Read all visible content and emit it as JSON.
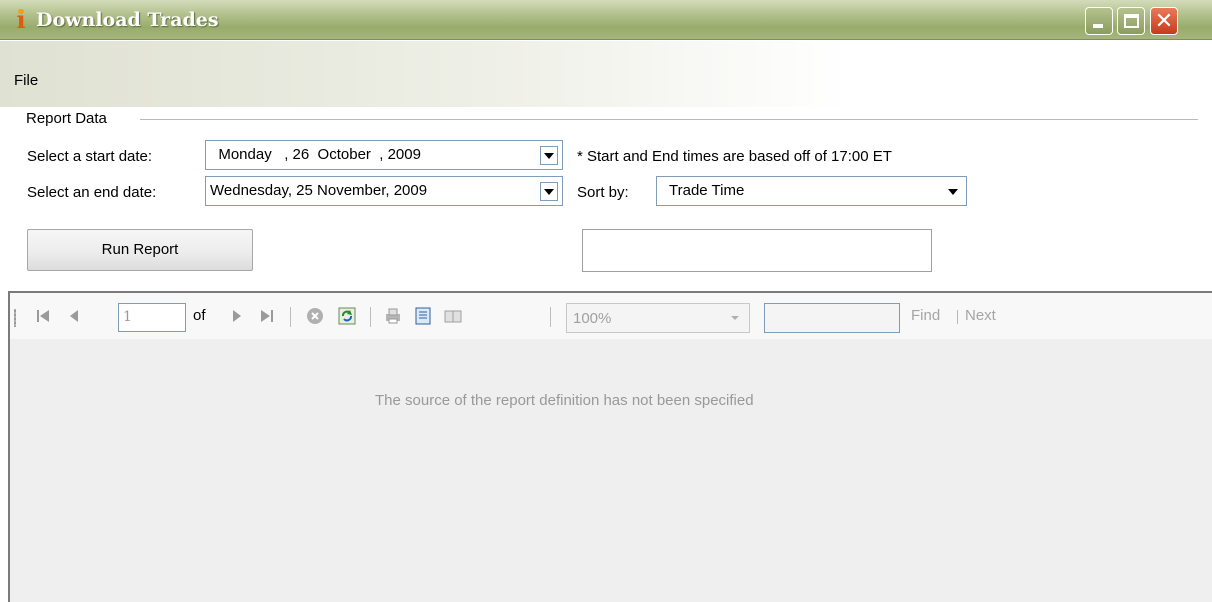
{
  "window": {
    "title": "Download Trades",
    "colors": {
      "titlebar": "#a5b57c",
      "close_button": "#c63a1a"
    }
  },
  "menu": {
    "file_label": "File"
  },
  "report_data": {
    "group_title": "Report Data",
    "start_date_label": "Select a start date:",
    "start_date_value": "  Monday   , 26  October  , 2009",
    "end_date_label": "Select an end date:",
    "end_date_value": "Wednesday, 25 November, 2009",
    "times_note": "* Start and End times are based off of 17:00 ET",
    "sort_by_label": "Sort by:",
    "sort_by_value": "Trade Time",
    "run_report_label": "Run Report",
    "status_value": ""
  },
  "viewer": {
    "toolbar": {
      "page_value": "1",
      "of_label": "of",
      "zoom_value": "100%",
      "find_value": "",
      "find_label": "Find",
      "separator": "|",
      "next_label": "Next",
      "icons": [
        "first-page-icon",
        "previous-page-icon",
        "next-page-icon",
        "last-page-icon",
        "stop-icon",
        "refresh-icon",
        "print-icon",
        "print-layout-icon",
        "page-setup-icon"
      ]
    },
    "message": "The source of the report definition has not been specified"
  }
}
